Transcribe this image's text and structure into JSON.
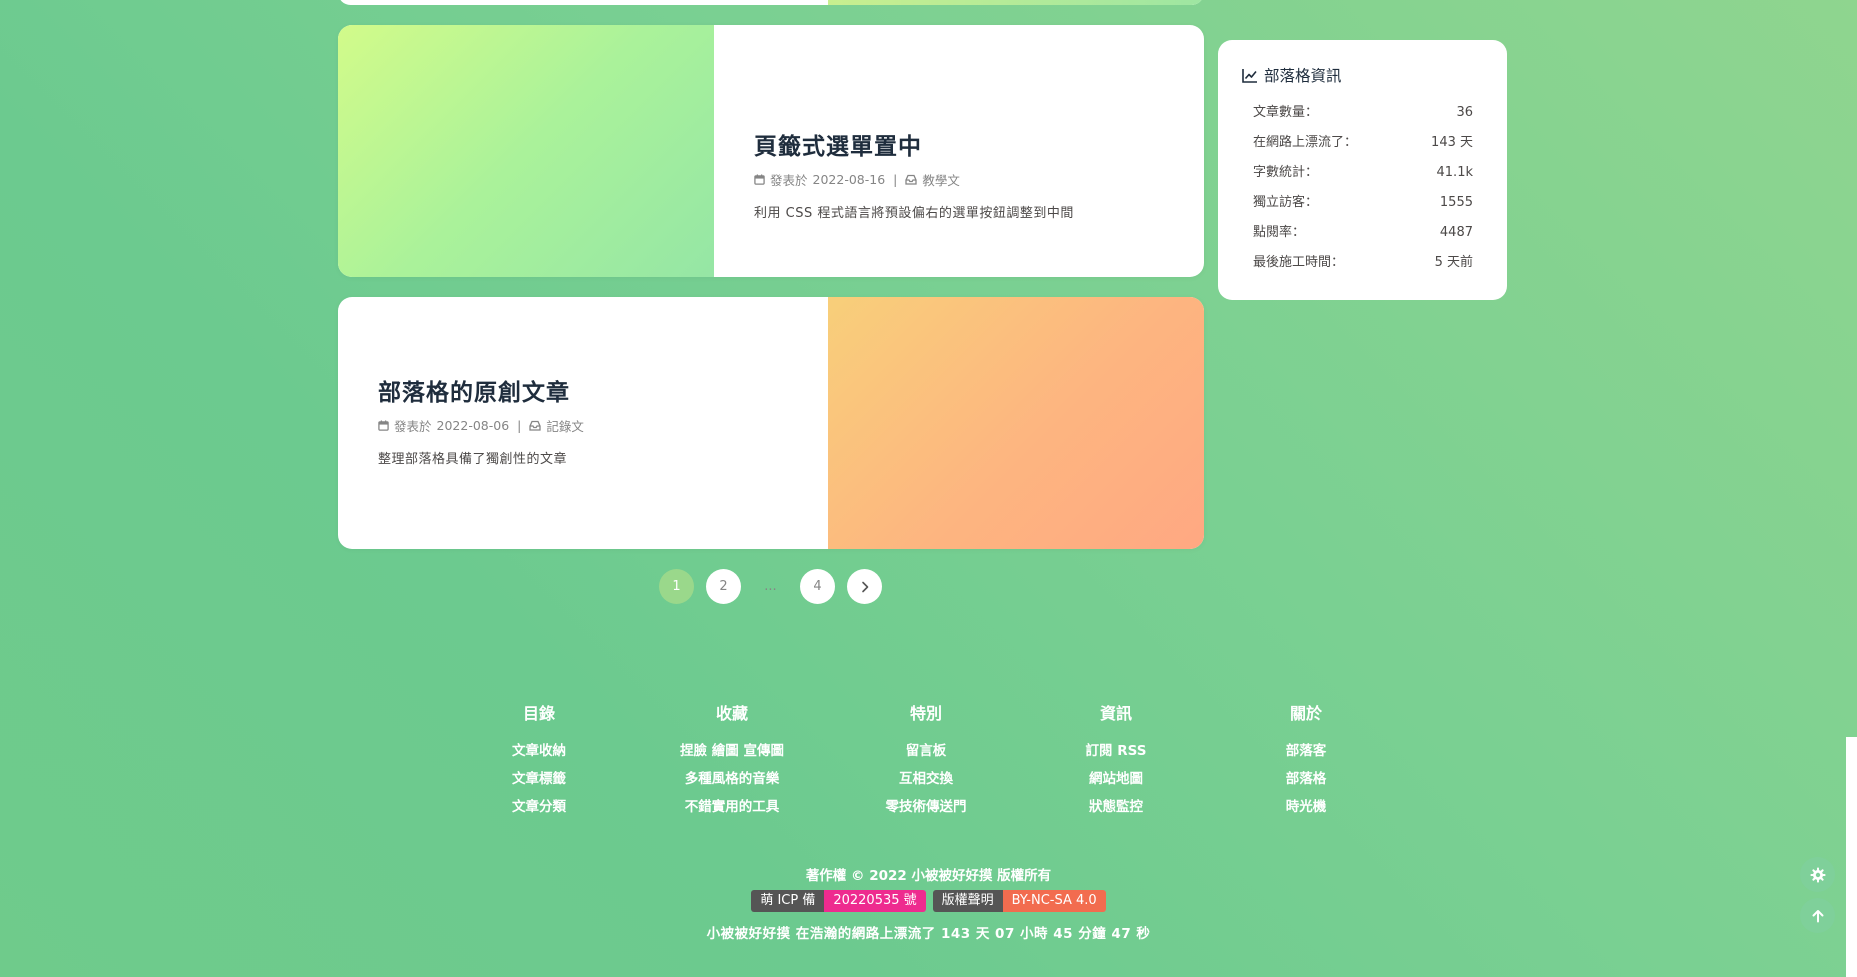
{
  "posts": [
    {
      "title": "頁籤式選單置中",
      "meta_prefix": "發表於",
      "date": "2022-08-16",
      "separator": "|",
      "category": "教學文",
      "description": "利用 CSS 程式語言將預設偏右的選單按鈕調整到中間"
    },
    {
      "title": "部落格的原創文章",
      "meta_prefix": "發表於",
      "date": "2022-08-06",
      "separator": "|",
      "category": "記錄文",
      "description": "整理部落格具備了獨創性的文章"
    }
  ],
  "pagination": {
    "pages": [
      "1",
      "2",
      "...",
      "4"
    ],
    "current": "1",
    "next_icon": "chevron-right-icon"
  },
  "sidebar": {
    "title": "部落格資訊",
    "icon": "line-chart-icon",
    "stats": [
      {
        "label": "文章數量：",
        "value": "36"
      },
      {
        "label": "在網路上漂流了：",
        "value": "143 天"
      },
      {
        "label": "字數統計：",
        "value": "41.1k"
      },
      {
        "label": "獨立訪客：",
        "value": "1555"
      },
      {
        "label": "點閱率：",
        "value": "4487"
      },
      {
        "label": "最後施工時間：",
        "value": "5 天前"
      }
    ]
  },
  "footer": {
    "columns": [
      {
        "title": "目錄",
        "links": [
          "文章收納",
          "文章標籤",
          "文章分類"
        ]
      },
      {
        "title": "收藏",
        "links": [
          "捏臉 繪圖 宣傳圖",
          "多種風格的音樂",
          "不錯實用的工具"
        ]
      },
      {
        "title": "特別",
        "links": [
          "留言板",
          "互相交換",
          "零技術傳送門"
        ]
      },
      {
        "title": "資訊",
        "links": [
          "訂閱 RSS",
          "網站地圖",
          "狀態監控"
        ]
      },
      {
        "title": "關於",
        "links": [
          "部落客",
          "部落格",
          "時光機"
        ]
      }
    ],
    "copyright": "著作權 © 2022 小被被好好摸 版權所有",
    "badges": [
      {
        "left": "萌 ICP 備",
        "right": "20220535 號",
        "color": "#ee2b8f"
      },
      {
        "left": "版權聲明",
        "right": "BY-NC-SA 4.0",
        "color": "#f26c4f"
      }
    ],
    "runtime": "小被被好好摸 在浩瀚的網路上漂流了 143 天 07 小時 45 分鐘 47 秒"
  },
  "floating": {
    "settings_icon": "gear-icon",
    "top_icon": "arrow-up-icon"
  },
  "colors": {
    "background_start": "#8fd58f",
    "background_end": "#6cca8f",
    "current_page": "#9ad88b",
    "text": "#1f2d3d"
  }
}
